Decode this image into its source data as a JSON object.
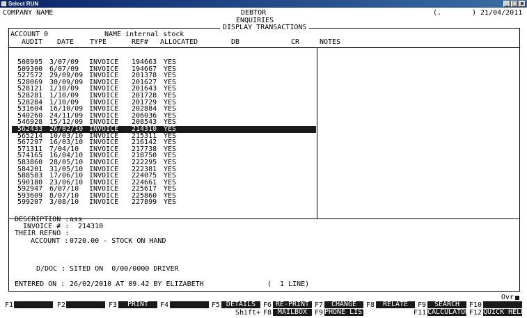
{
  "window": {
    "title": "Select RUN",
    "minimize": "_",
    "maximize": "□",
    "close": "x"
  },
  "header": {
    "company": "COMPANY NAME",
    "module": "DEBTOR",
    "submodule": "ENQUIRIES",
    "panel_title": "DISPLAY TRANSACTIONS",
    "phone_prefix": "(.",
    "phone_suffix": ") 21/04/2011"
  },
  "account": {
    "account_label": "ACCOUNT 0",
    "name_label": "NAME",
    "name_value": "internal stock"
  },
  "columns": {
    "audit": "AUDIT",
    "date": "DATE",
    "type": "TYPE",
    "ref": "REF#",
    "allocated": "ALLOCATED",
    "db": "DB",
    "cr": "CR",
    "notes": "NOTES"
  },
  "transactions": [
    {
      "audit": "508995",
      "date": "3/07/09",
      "type": "INVOICE",
      "ref": "194663",
      "allocated": "YES"
    },
    {
      "audit": "509300",
      "date": "6/07/09",
      "type": "INVOICE",
      "ref": "194667",
      "allocated": "YES"
    },
    {
      "audit": "527572",
      "date": "29/09/09",
      "type": "INVOICE",
      "ref": "201378",
      "allocated": "YES"
    },
    {
      "audit": "528069",
      "date": "30/09/09",
      "type": "INVOICE",
      "ref": "201627",
      "allocated": "YES"
    },
    {
      "audit": "528121",
      "date": "1/10/09",
      "type": "INVOICE",
      "ref": "201643",
      "allocated": "YES"
    },
    {
      "audit": "528281",
      "date": "1/10/09",
      "type": "INVOICE",
      "ref": "201728",
      "allocated": "YES"
    },
    {
      "audit": "528284",
      "date": "1/10/09",
      "type": "INVOICE",
      "ref": "201729",
      "allocated": "YES"
    },
    {
      "audit": "531604",
      "date": "16/10/09",
      "type": "INVOICE",
      "ref": "202884",
      "allocated": "YES"
    },
    {
      "audit": "540260",
      "date": "24/11/09",
      "type": "INVOICE",
      "ref": "206036",
      "allocated": "YES"
    },
    {
      "audit": "546928",
      "date": "15/12/09",
      "type": "INVOICE",
      "ref": "208543",
      "allocated": "YES"
    },
    {
      "audit": "562433",
      "date": "26/02/10",
      "type": "INVOICE",
      "ref": "214310",
      "allocated": "YES",
      "selected": true
    },
    {
      "audit": "565214",
      "date": "10/03/10",
      "type": "INVOICE",
      "ref": "215311",
      "allocated": "YES"
    },
    {
      "audit": "567297",
      "date": "16/03/10",
      "type": "INVOICE",
      "ref": "216142",
      "allocated": "YES"
    },
    {
      "audit": "571311",
      "date": "7/04/10",
      "type": "INVOICE",
      "ref": "217738",
      "allocated": "YES"
    },
    {
      "audit": "574165",
      "date": "16/04/10",
      "type": "INVOICE",
      "ref": "218750",
      "allocated": "YES"
    },
    {
      "audit": "583860",
      "date": "28/05/10",
      "type": "INVOICE",
      "ref": "222295",
      "allocated": "YES"
    },
    {
      "audit": "584201",
      "date": "31/05/10",
      "type": "INVOICE",
      "ref": "222381",
      "allocated": "YES"
    },
    {
      "audit": "588583",
      "date": "17/06/10",
      "type": "INVOICE",
      "ref": "224075",
      "allocated": "YES"
    },
    {
      "audit": "590180",
      "date": "23/06/10",
      "type": "INVOICE",
      "ref": "224661",
      "allocated": "YES"
    },
    {
      "audit": "592947",
      "date": "6/07/10",
      "type": "INVOICE",
      "ref": "225617",
      "allocated": "YES"
    },
    {
      "audit": "593609",
      "date": "8/07/10",
      "type": "INVOICE",
      "ref": "225860",
      "allocated": "YES"
    },
    {
      "audit": "599207",
      "date": "3/08/10",
      "type": "INVOICE",
      "ref": "227899",
      "allocated": "YES"
    }
  ],
  "detail": {
    "description_label": "DESCRIPTION :",
    "description_value": "ass",
    "invoice_label": "INVOICE # :",
    "invoice_value": "214310",
    "their_refno_label": "THEIR REFNO :",
    "account_label": "ACCOUNT :",
    "account_value": "0720.00 - STOCK ON HAND",
    "ddoc_label": "D/DOC :",
    "ddoc_value": "SITED ON  0/00/0000 DRIVER",
    "entered_label": "ENTERED ON :",
    "entered_value": "26/02/2010 AT 09.42 BY ELIZABETH",
    "lines": "(  1 LINE)"
  },
  "status": {
    "ovr": "Ovr"
  },
  "function_keys": {
    "f1": "F1",
    "f2": "F2",
    "f3": "F3",
    "f3_label": "PRINT",
    "f4": "F4",
    "f5": "F5",
    "f5_label": "DETAILS",
    "f6": "F6",
    "f6_label": "RE-PRINT",
    "f7": "F7",
    "f7_label": "CHANGE",
    "f8": "F8",
    "f8_label": "RELATE",
    "f9": "F9",
    "f9_label": "SEARCH",
    "f10": "F10",
    "shift": "Shift+",
    "sf8": "F8",
    "sf8_label": "MAILBOX",
    "sf9": "F9",
    "sf9_label": "PHONE LIST",
    "f11": "F11",
    "f11_label": "CALCULATOR",
    "f12": "F12",
    "f12_label": "QUICK HELP"
  }
}
